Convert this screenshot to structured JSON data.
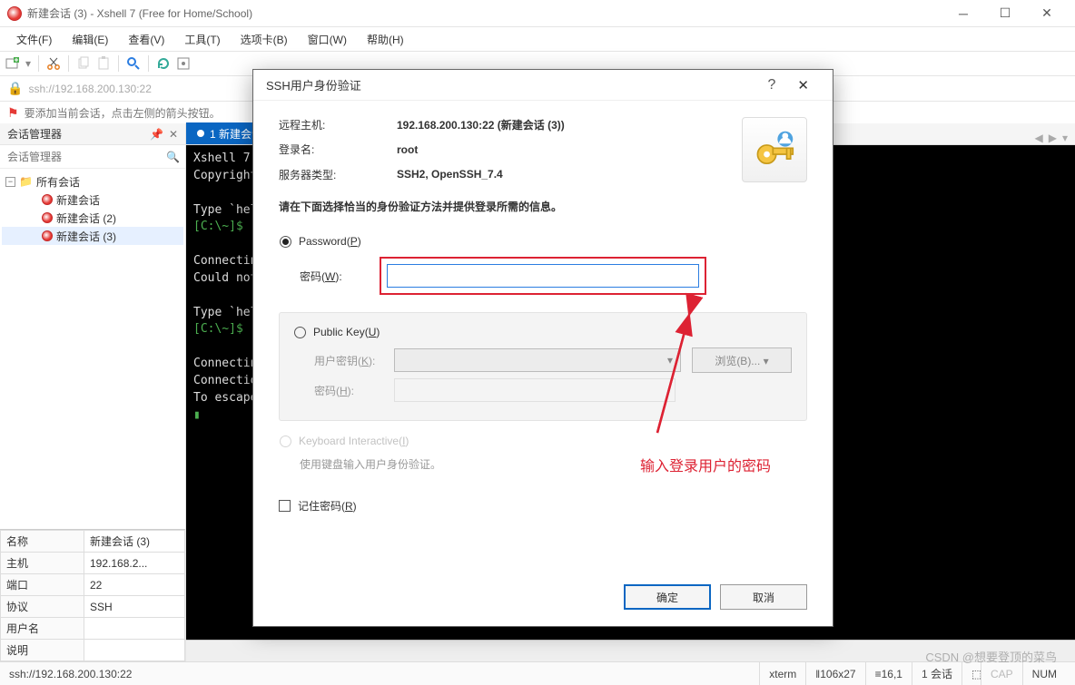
{
  "title": "新建会话 (3) - Xshell 7 (Free for Home/School)",
  "menus": [
    "文件(F)",
    "编辑(E)",
    "查看(V)",
    "工具(T)",
    "选项卡(B)",
    "窗口(W)",
    "帮助(H)"
  ],
  "address": "ssh://192.168.200.130:22",
  "hint": "要添加当前会话，点击左侧的箭头按钮。",
  "session_manager": {
    "title": "会话管理器",
    "root": "所有会话",
    "items": [
      "新建会话",
      "新建会话 (2)",
      "新建会话 (3)"
    ],
    "selected_index": 2
  },
  "props": [
    [
      "名称",
      "新建会话 (3)"
    ],
    [
      "主机",
      "192.168.2..."
    ],
    [
      "端口",
      "22"
    ],
    [
      "协议",
      "SSH"
    ],
    [
      "用户名",
      ""
    ],
    [
      "说明",
      ""
    ]
  ],
  "tab": {
    "label": "1 新建会话 (3)"
  },
  "terminal": "Xshell 7 (Build 0113)\nCopyright (c) 2020 NetSarang Computer, Inc. All rights reserved.\n\nType `help' to learn how to use Xshell prompt.\n[C:\\~]$ \n\nConnecting to 192.168.200.130:22...\nCould not connect to '192.168.200.130' (port 22): Connection failed.\n\nType `help' to learn how to use Xshell prompt.\n[C:\\~]$ \n\nConnecting to 192.168.200.130:22...\nConnection established.\nTo escape to local shell, press 'Ctrl+Alt+]'.\n",
  "dialog": {
    "title": "SSH用户身份验证",
    "remote_label": "远程主机:",
    "remote_value": "192.168.200.130:22 (新建会话 (3))",
    "login_label": "登录名:",
    "login_value": "root",
    "server_label": "服务器类型:",
    "server_value": "SSH2, OpenSSH_7.4",
    "prompt": "请在下面选择恰当的身份验证方法并提供登录所需的信息。",
    "radio_password": "Password(P)",
    "pwd_label": "密码(W):",
    "pwd_value": "",
    "radio_pubkey": "Public Key(U)",
    "userkey_label": "用户密钥(K):",
    "browse": "浏览(B)...   ▾",
    "pass_label": "密码(H):",
    "radio_kbi": "Keyboard Interactive(I)",
    "kbi_note": "使用键盘输入用户身份验证。",
    "remember": "记住密码(R)",
    "ok": "确定",
    "cancel": "取消"
  },
  "annotation": "输入登录用户的密码",
  "status": {
    "addr": "ssh://192.168.200.130:22",
    "term": "xterm",
    "size": "106x27",
    "pos": "16,1",
    "sess": "1 会话",
    "caps": "CAP",
    "num": "NUM"
  },
  "watermark": "CSDN @想要登顶的菜鸟"
}
